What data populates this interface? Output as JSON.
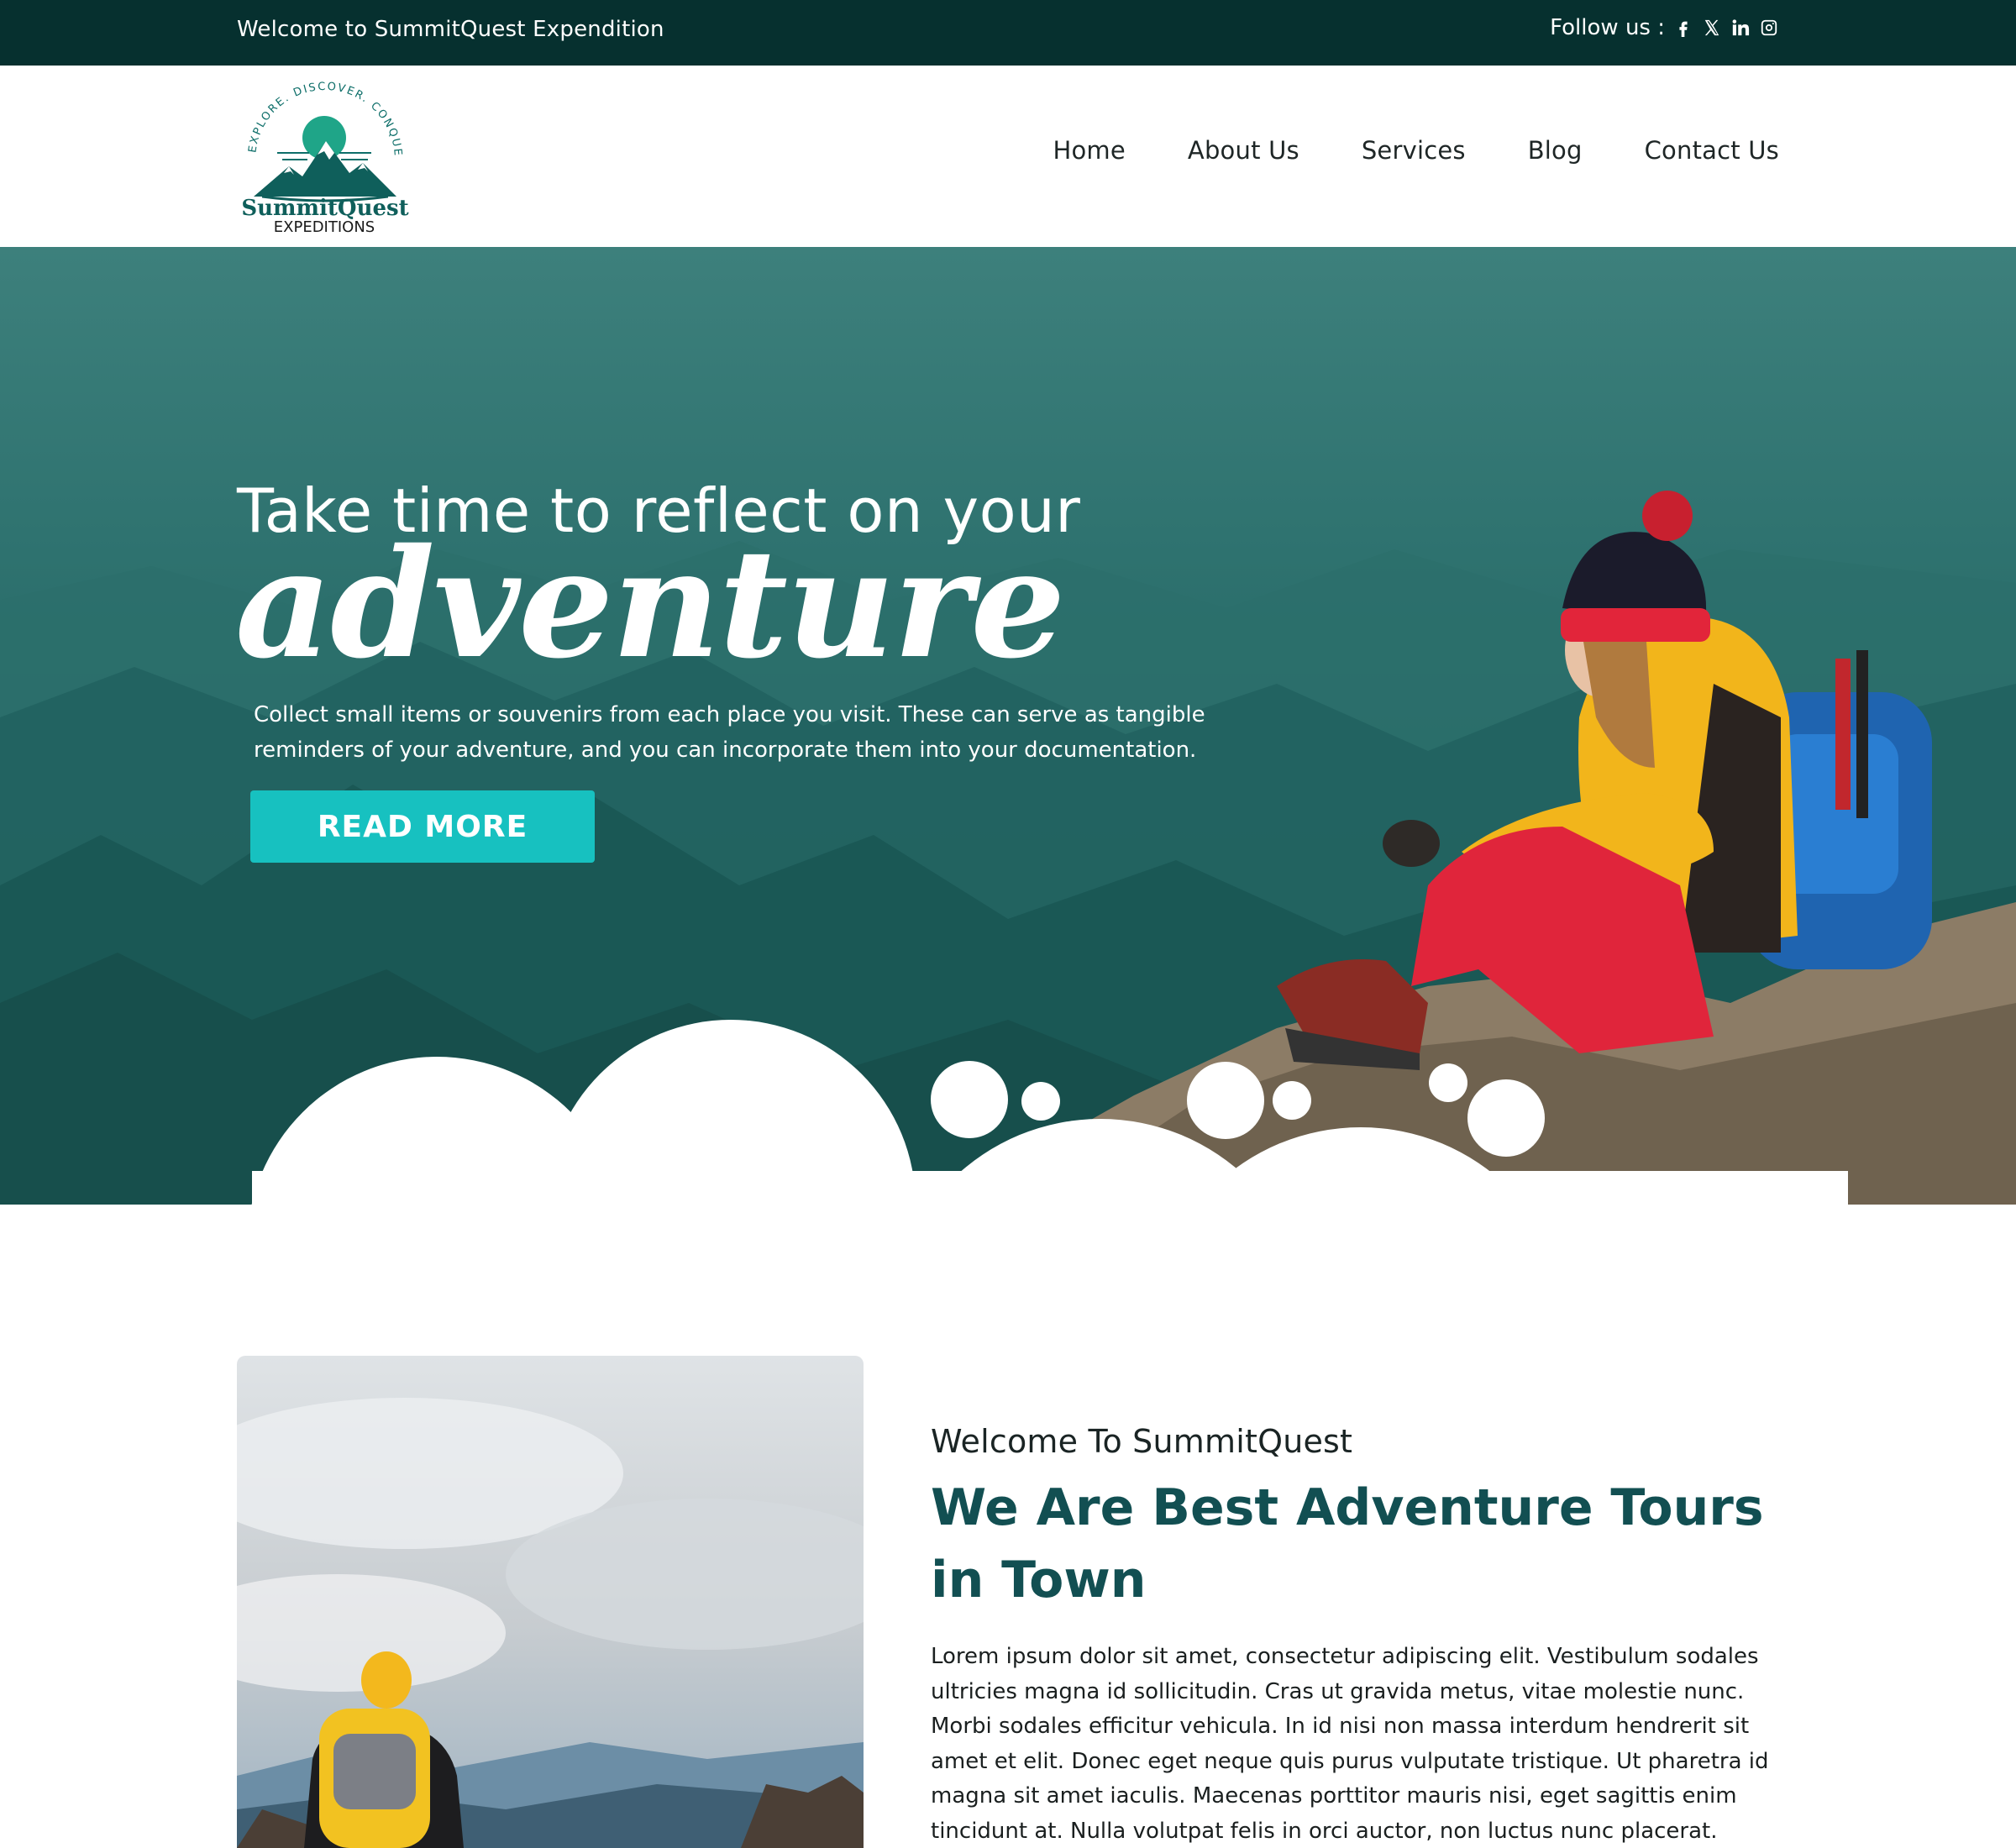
{
  "topbar": {
    "welcome": "Welcome to SummitQuest Expendition",
    "follow_label": "Follow us :",
    "social": [
      "facebook-icon",
      "x-icon",
      "linkedin-icon",
      "instagram-icon"
    ]
  },
  "header": {
    "logo": {
      "tagline": "EXPLORE. DISCOVER. CONQUER.",
      "name": "SummitQuest",
      "subtitle": "EXPEDITIONS"
    },
    "nav": [
      "Home",
      "About Us",
      "Services",
      "Blog",
      "Contact Us"
    ]
  },
  "hero": {
    "line1": "Take time to reflect on your",
    "line2": "adventure",
    "description": "Collect small items or souvenirs from each place you visit. These can serve as tangible reminders of your adventure, and you can incorporate them into your documentation.",
    "cta": "READ MORE"
  },
  "about": {
    "kicker": "Welcome To SummitQuest",
    "headline": "We Are Best Adventure Tours in Town",
    "body": "Lorem ipsum dolor sit amet, consectetur adipiscing elit. Vestibulum sodales ultricies magna id sollicitudin. Cras ut gravida metus, vitae molestie nunc. Morbi sodales efficitur vehicula. In id nisi non massa interdum hendrerit sit amet et elit. Donec eget neque quis purus vulputate tristique. Ut pharetra id magna sit amet iaculis. Maecenas porttitor mauris nisi, eget sagittis enim tincidunt at. Nulla volutpat felis in orci auctor, non luctus nunc placerat."
  },
  "colors": {
    "topbar": "#06302f",
    "hero_teal": "#246663",
    "cta": "#17c1c0",
    "headline": "#124f52"
  }
}
